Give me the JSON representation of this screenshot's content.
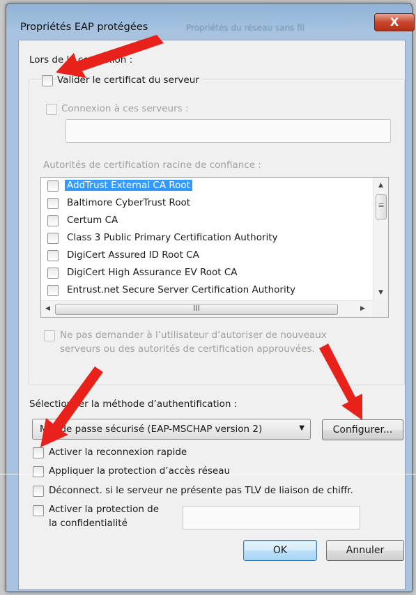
{
  "window": {
    "title": "Propriétés EAP protégées",
    "background_title": "Propriétés du réseau sans fil",
    "close_glyph": "X"
  },
  "connection": {
    "heading": "Lors de la connexion :",
    "validate_cert_label": "Valider le certificat du serveur",
    "connect_servers_label": "Connexion à ces serveurs :",
    "servers_value": "",
    "trusted_roots_label": "Autorités de certification racine de confiance :",
    "certificates": [
      {
        "label": "AddTrust External CA Root",
        "selected": true
      },
      {
        "label": "Baltimore CyberTrust Root",
        "selected": false
      },
      {
        "label": "Certum CA",
        "selected": false
      },
      {
        "label": "Class 3 Public Primary Certification Authority",
        "selected": false
      },
      {
        "label": "DigiCert Assured ID Root CA",
        "selected": false
      },
      {
        "label": "DigiCert High Assurance EV Root CA",
        "selected": false
      },
      {
        "label": "Entrust.net Secure Server Certification Authority",
        "selected": false
      }
    ],
    "hscroll_grip": "III",
    "no_prompt_label_line1": "Ne pas demander à l’utilisateur d’autoriser de nouveaux",
    "no_prompt_label_line2": "serveurs ou des autorités de certification approuvées."
  },
  "auth": {
    "heading": "Sélectionner la méthode d’authentification :",
    "method_value": "Mot de passe sécurisé (EAP-MSCHAP version 2)",
    "configure_label": "Configurer...",
    "fast_reconnect_label": "Activer la reconnexion rapide",
    "nap_label": "Appliquer la protection d’accès réseau",
    "disconnect_label": "Déconnect. si le serveur ne présente pas TLV de liaison de chiffr.",
    "privacy_label_line1": "Activer la protection de",
    "privacy_label_line2": "la confidentialité",
    "privacy_value": ""
  },
  "buttons": {
    "ok_label": "OK",
    "cancel_label": "Annuler"
  },
  "colors": {
    "annotation_arrow": "#e8211a",
    "selection": "#3399ff"
  },
  "icons": {
    "close": "close-icon",
    "dropdown": "chevron-down-icon",
    "scroll_up": "arrow-up-icon",
    "scroll_down": "arrow-down-icon",
    "scroll_left": "arrow-left-icon",
    "scroll_right": "arrow-right-icon"
  }
}
